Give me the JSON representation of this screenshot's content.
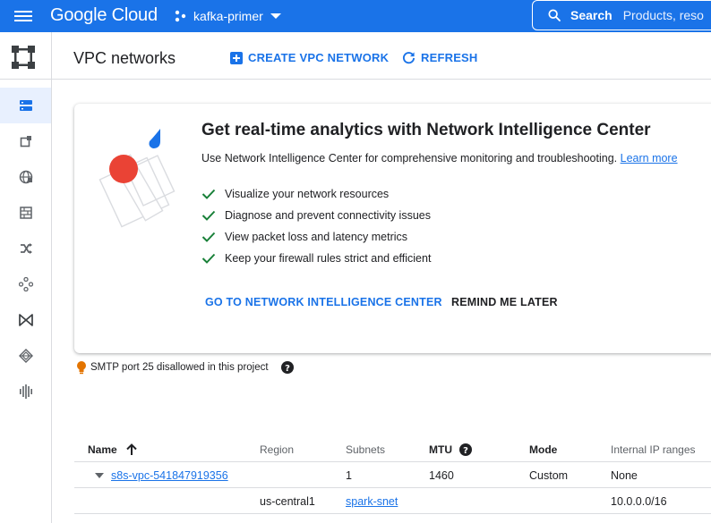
{
  "topbar": {
    "logo": "Google Cloud",
    "project": "kafka-primer",
    "search_label": "Search",
    "search_placeholder": "Products, reso"
  },
  "page": {
    "title": "VPC networks",
    "create_label": "CREATE VPC NETWORK",
    "refresh_label": "REFRESH"
  },
  "promo": {
    "title": "Get real-time analytics with Network Intelligence Center",
    "description": "Use Network Intelligence Center for comprehensive monitoring and troubleshooting.",
    "learn_more": "Learn more",
    "features": [
      "Visualize your network resources",
      "Diagnose and prevent connectivity issues",
      "View packet loss and latency metrics",
      "Keep your firewall rules strict and efficient"
    ],
    "primary_action": "GO TO NETWORK INTELLIGENCE CENTER",
    "secondary_action": "REMIND ME LATER"
  },
  "notice": {
    "text": "SMTP port 25 disallowed in this project"
  },
  "table": {
    "headers": {
      "name": "Name",
      "region": "Region",
      "subnets": "Subnets",
      "mtu": "MTU",
      "mode": "Mode",
      "internal_ip": "Internal IP ranges"
    },
    "rows": [
      {
        "name": "s8s-vpc-541847919356",
        "region": "",
        "subnets": "1",
        "mtu": "1460",
        "mode": "Custom",
        "internal_ip": "None"
      },
      {
        "name": "",
        "region": "us-central1",
        "subnets": "spark-snet",
        "mtu": "",
        "mode": "",
        "internal_ip": "10.0.0.0/16"
      }
    ]
  },
  "colors": {
    "brand_blue": "#1a73e8",
    "check_green": "#188038",
    "notice_orange": "#e37400",
    "art_red": "#ea4335"
  }
}
